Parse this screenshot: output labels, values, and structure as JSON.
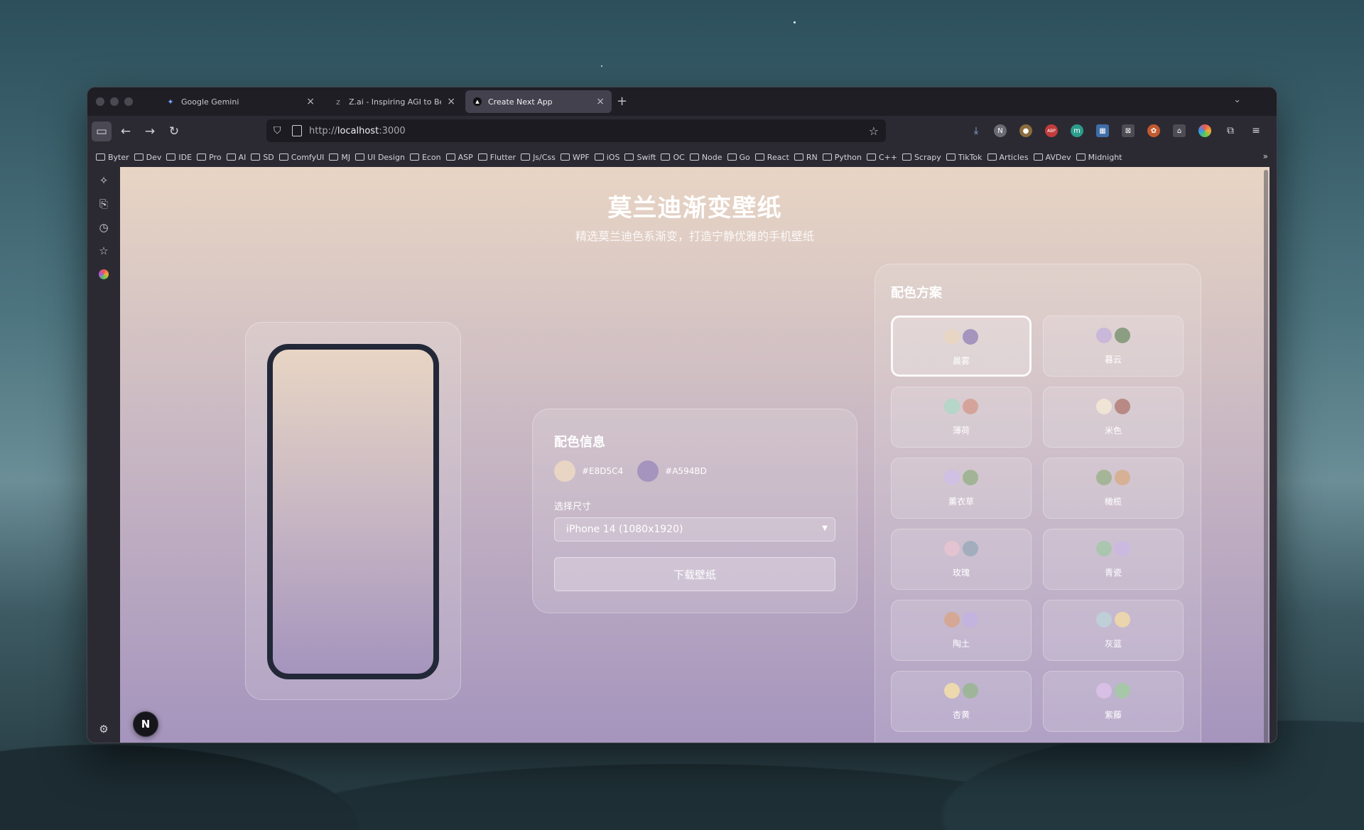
{
  "browser": {
    "tabs": [
      {
        "title": "Google Gemini",
        "favicon": "gemini-icon",
        "active": false
      },
      {
        "title": "Z.ai - Inspiring AGI to Benefit Hu",
        "favicon": "zai-icon",
        "active": false
      },
      {
        "title": "Create Next App",
        "favicon": "nextjs-icon",
        "active": true
      }
    ],
    "url_scheme": "http://",
    "url_host": "localhost",
    "url_port": ":3000",
    "bookmarks": [
      "Byter",
      "Dev",
      "IDE",
      "Pro",
      "AI",
      "SD",
      "ComfyUI",
      "MJ",
      "UI Design",
      "Econ",
      "ASP",
      "Flutter",
      "Js/Css",
      "WPF",
      "iOS",
      "Swift",
      "OC",
      "Node",
      "Go",
      "React",
      "RN",
      "Python",
      "C++",
      "Scrapy",
      "TikTok",
      "Articles",
      "AVDev",
      "Midnight"
    ],
    "extension_icons": [
      "download-icon",
      "notion-icon",
      "extension-icon",
      "adblock-icon",
      "extension-icon",
      "extension-icon",
      "extension-icon",
      "extension-icon",
      "extension-icon",
      "extension-icon",
      "extensions-puzzle-icon",
      "menu-icon"
    ]
  },
  "page": {
    "title": "莫兰迪渐变壁纸",
    "subtitle": "精选莫兰迪色系渐变，打造宁静优雅的手机壁纸",
    "gradient": {
      "top": "#E8D5C4",
      "bottom": "#A594BD"
    },
    "info": {
      "heading": "配色信息",
      "color1": "#E8D5C4",
      "color2": "#A594BD",
      "size_label": "选择尺寸",
      "size_value": "iPhone 14 (1080x1920)",
      "download_label": "下载壁纸"
    },
    "schemes_heading": "配色方案",
    "schemes": [
      {
        "name": "晨雾",
        "c1": "#E8D5C4",
        "c2": "#A594BD",
        "selected": true
      },
      {
        "name": "暮云",
        "c1": "#C9B8DA",
        "c2": "#8B9E82",
        "selected": false
      },
      {
        "name": "薄荷",
        "c1": "#B5D6C8",
        "c2": "#D4A49A",
        "selected": false
      },
      {
        "name": "米色",
        "c1": "#F0E4D6",
        "c2": "#B88985",
        "selected": false
      },
      {
        "name": "薰衣草",
        "c1": "#CFC0E4",
        "c2": "#A1B596",
        "selected": false
      },
      {
        "name": "橄榄",
        "c1": "#A5B597",
        "c2": "#D6B196",
        "selected": false
      },
      {
        "name": "玫瑰",
        "c1": "#E3C3CF",
        "c2": "#A2AEBD",
        "selected": false
      },
      {
        "name": "青瓷",
        "c1": "#ABC6AF",
        "c2": "#CBB9E2",
        "selected": false
      },
      {
        "name": "陶土",
        "c1": "#D5A895",
        "c2": "#C2B4DF",
        "selected": false
      },
      {
        "name": "灰蓝",
        "c1": "#BFCFD8",
        "c2": "#EAD5AE",
        "selected": false
      },
      {
        "name": "杏黄",
        "c1": "#EDD9AE",
        "c2": "#9EB59A",
        "selected": false
      },
      {
        "name": "紫藤",
        "c1": "#D7BFE6",
        "c2": "#A7C7A9",
        "selected": false
      }
    ],
    "next_badge": "N"
  }
}
